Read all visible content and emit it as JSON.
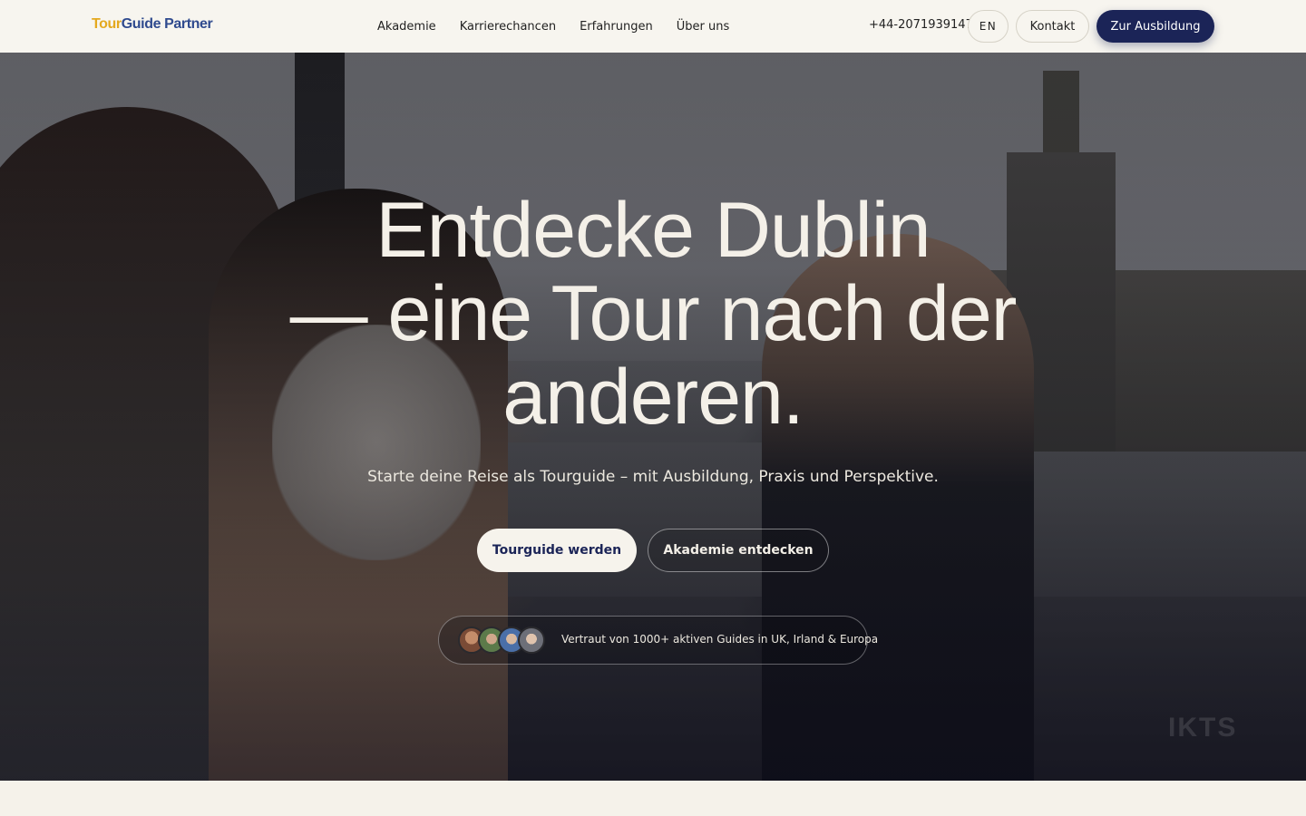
{
  "header": {
    "logo_part1": "Tour",
    "logo_part2": "Guide Partner",
    "nav": [
      "Akademie",
      "Karrierechancen",
      "Erfahrungen",
      "Über uns"
    ],
    "phone": "+44-2071939147",
    "lang": "EN",
    "contact_label": "Kontakt",
    "cta_label": "Zur Ausbildung"
  },
  "hero": {
    "headline_line1": "Entdecke Dublin",
    "headline_line2": "— eine Tour nach der",
    "headline_line3": "anderen.",
    "subline": "Starte deine Reise als Tourguide – mit Ausbildung, Praxis und Perspektive.",
    "primary_button": "Tourguide werden",
    "secondary_button": "Akademie entdecken",
    "trust_text": "Vertraut von 1000+ aktiven Guides in UK, Irland & Europa",
    "watermark": "IKTS"
  },
  "colors": {
    "brand_navy": "#1b2457",
    "logo_yellow": "#e4a91f",
    "logo_blue": "#2f4a8e",
    "background_cream": "#f5f2ea"
  }
}
